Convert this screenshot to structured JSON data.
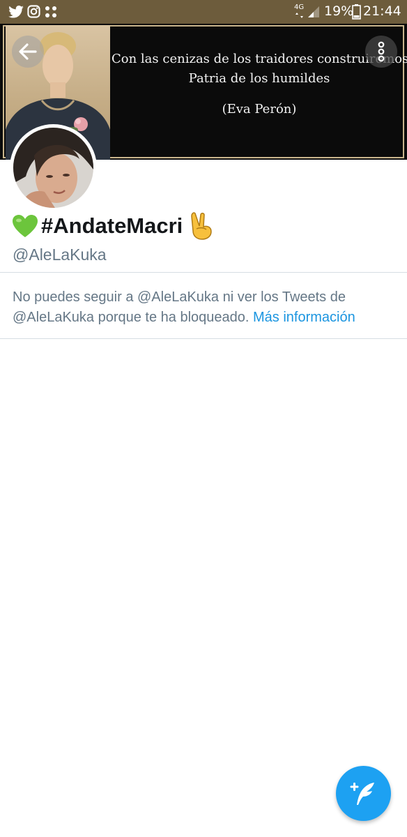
{
  "status_bar": {
    "network": "4G",
    "battery": "19%",
    "time": "21:44",
    "icons": [
      "twitter-icon",
      "instagram-icon",
      "grid-dots-icon",
      "signal-icon",
      "battery-icon"
    ]
  },
  "banner": {
    "quote_line_1": "Con las cenizas de los traidores construiremos la",
    "quote_line_2": "Patria de los humildes",
    "attribution": "(Eva Perón)"
  },
  "profile": {
    "display_name": "#AndateMacri",
    "handle": "@AleLaKuka"
  },
  "blocked_notice": {
    "line_1": "No puedes seguir a @AleLaKuka ni ver los Tweets de",
    "line_2": "@AleLaKuka porque te ha bloqueado.",
    "link": "Más información"
  },
  "colors": {
    "status_bar": "#6d5c3c",
    "link": "#1b95e0",
    "fab": "#1da1f2",
    "text_primary": "#14171a",
    "text_secondary": "#657786"
  }
}
